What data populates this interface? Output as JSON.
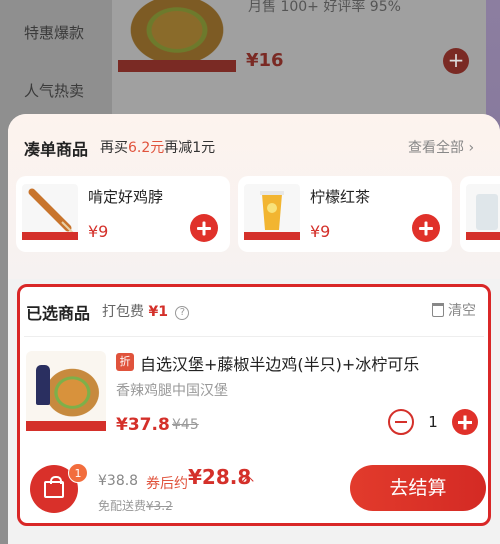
{
  "background": {
    "categories": [
      "特惠爆款",
      "人气热卖"
    ],
    "item_sales": "月售 100+ 好评率 95%",
    "item_price": "¥16"
  },
  "addon": {
    "title": "凑单商品",
    "promo_prefix": "再买",
    "promo_amount": "6.2元",
    "promo_suffix": "再减1元",
    "see_all": "查看全部",
    "items": [
      {
        "name": "啃定好鸡脖",
        "price": "¥9"
      },
      {
        "name": "柠檬红茶",
        "price": "¥9"
      }
    ]
  },
  "selected": {
    "title": "已选商品",
    "packaging_label": "打包费",
    "packaging_fee": "¥1",
    "clear_label": "清空",
    "product": {
      "discount_tag": "折",
      "name": "自选汉堡+藤椒半边鸡(半只)+冰柠可乐",
      "store": "香辣鸡腿中国汉堡",
      "price": "¥37.8",
      "original_price": "¥45",
      "quantity": "1"
    }
  },
  "footer": {
    "cart_count": "1",
    "original_total": "¥38.8",
    "after_coupon_label": "券后约",
    "final_total": "¥28.8",
    "delivery_label": "免配送费",
    "delivery_original": "¥3.2",
    "checkout_label": "去结算"
  },
  "colors": {
    "accent": "#d4302a",
    "panel_border": "#d92727",
    "promo": "#e0533c"
  }
}
